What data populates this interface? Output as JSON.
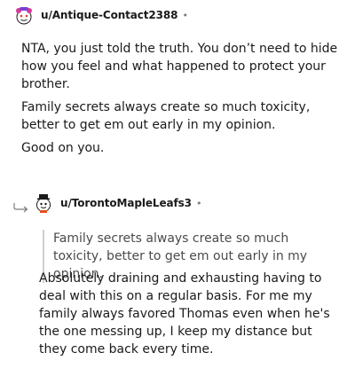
{
  "comment1": {
    "username": "u/Antique-Contact2388",
    "separator": "•",
    "paragraphs": [
      "NTA, you just told the truth. You don’t need to hide how you feel and what happened to protect your brother.",
      "Family secrets always create so much toxicity, better to get em out early in my opinion.",
      "Good on you."
    ],
    "avatar_icon": "snoo-avatar-icon"
  },
  "comment2": {
    "username": "u/TorontoMapleLeafs3",
    "separator": "•",
    "quote": "Family secrets always create so much toxicity, better to get em out early in my opinion.",
    "body": "Absolutely draining and exhausting having to deal with this on a regular basis. For me my family always favored Thomas even when he's the one messing up, I keep my distance but they come back every time.",
    "avatar_icon": "snoo-avatar-icon"
  },
  "colors": {
    "text": "#1a1a1b",
    "quote_text": "#4a4a4b",
    "quote_border": "#cfcfcf",
    "muted": "#7c7c7c"
  }
}
